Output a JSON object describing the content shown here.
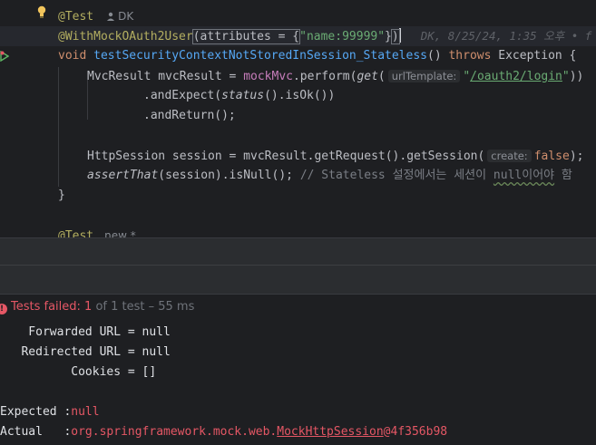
{
  "editor": {
    "blame_author": "DK",
    "blame_line": "DK, 8/25/24, 1:35 오후 • f",
    "url_hint": "urlTemplate:",
    "create_hint": "create:",
    "next_author": "new *",
    "lines": {
      "test_ann": "@Test",
      "mock_ann": "@WithMockOAuth2User",
      "mock_args_open": "(attributes = {",
      "mock_str": "\"name:99999\"",
      "mock_close_brace": "}",
      "mock_close_paren": ")",
      "void_kw": "void",
      "method_name": "testSecurityContextNotStoredInSession_Stateless",
      "method_parens": "()",
      "throws_kw": "throws",
      "exception": "Exception {",
      "l1_type": "MvcResult mvcResult = ",
      "l1_field": "mockMvc",
      "l1_perform": ".perform(",
      "l1_get": "get",
      "l1_paren": "(",
      "l1_url_q1": "\"",
      "l1_url": "/oauth2/login",
      "l1_url_q2": "\"",
      "l1_end": "))",
      "l2_pre": ".andExpect(",
      "l2_status": "status",
      "l2_rest": "().isOk())",
      "l3": ".andReturn();",
      "l4_pre": "HttpSession session = mvcResult.getRequest().getSession(",
      "l4_false": "false",
      "l4_end": ");",
      "l5_assert": "assertThat",
      "l5_rest": "(session).isNull(); ",
      "l5_comment_a": "// Stateless 설정에서는 세션이 ",
      "l5_comment_b": "null이어야",
      "l5_comment_c": " 함",
      "close_brace": "}",
      "next_test": "@Test"
    }
  },
  "test_status": {
    "label": "Tests failed:",
    "failed_count": "1",
    "rest": " of 1 test – 55 ms"
  },
  "console": {
    "forwarded": "    Forwarded URL = null",
    "redirected": "   Redirected URL = null",
    "cookies": "          Cookies = []",
    "expected_label": "Expected :",
    "expected_value": "null",
    "actual_label": "Actual   :",
    "actual_value_a": "org.springframework.mock.web.",
    "actual_value_b": "MockHttpSession",
    "actual_value_c": "@4f356b98"
  },
  "colors": {
    "background": "#1e1f22",
    "keyword": "#cf8e6d",
    "annotation": "#b3ae60",
    "function": "#56a8f5",
    "string": "#6aab73",
    "error": "#e55765"
  }
}
